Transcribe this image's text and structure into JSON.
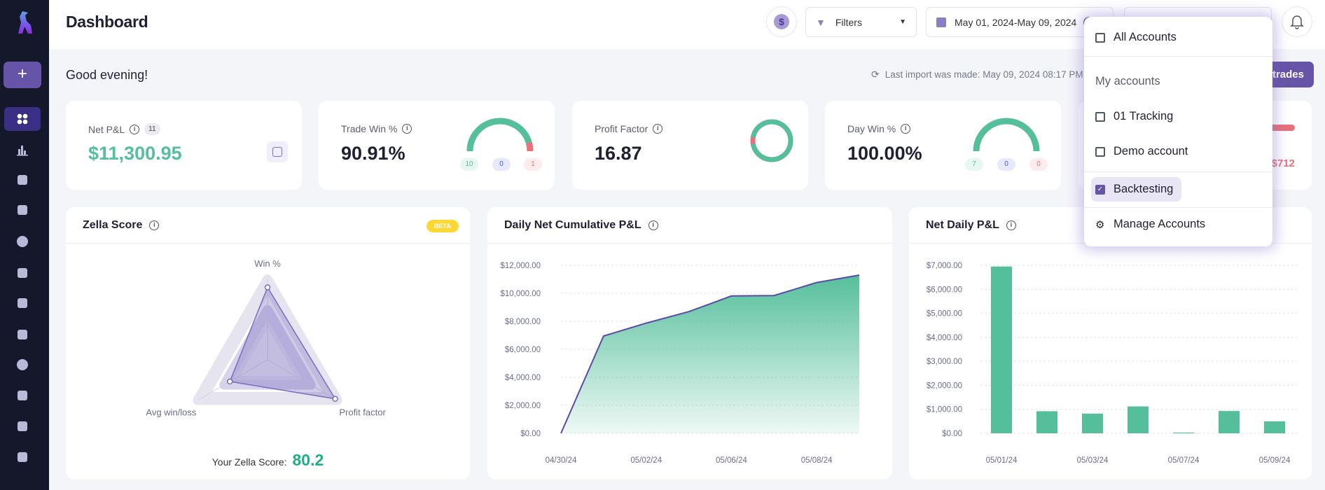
{
  "header": {
    "title": "Dashboard",
    "filters_label": "Filters",
    "date_range": "May 01, 2024-May 09, 2024"
  },
  "greeting": "Good evening!",
  "last_import": "Last import was made: May 09, 2024 08:17 PM",
  "import_button": "trades",
  "colors": {
    "accent": "#6554a7",
    "positive": "#55bf9b",
    "negative": "#e8717a",
    "sidebar": "#15172a"
  },
  "sidebar": {
    "items": [
      "dashboard-icon",
      "reports-icon",
      "daily-journal-icon",
      "trade-view-icon",
      "alert-icon",
      "academy-icon",
      "notebook-icon",
      "playbook-icon",
      "replay-icon",
      "backtesting-icon",
      "mentor-icon",
      "resources-icon"
    ],
    "active": 0
  },
  "stats": {
    "net_pnl": {
      "label": "Net P&L",
      "count": "11",
      "value": "$11,300.95"
    },
    "trade_win": {
      "label": "Trade Win %",
      "value": "90.91%",
      "wins": "10",
      "breakeven": "0",
      "losses": "1",
      "win_fraction": 0.9091
    },
    "profit_factor": {
      "label": "Profit Factor",
      "value": "16.87",
      "profit_fraction": 0.944
    },
    "day_win": {
      "label": "Day Win %",
      "value": "100.00%",
      "wins": "7",
      "breakeven": "0",
      "losses": "0",
      "win_fraction": 1.0
    },
    "avg_win_loss": {
      "loss_value": "-$712"
    }
  },
  "dropdown": {
    "all_accounts": "All Accounts",
    "section": "My accounts",
    "accounts": [
      {
        "name": "01 Tracking",
        "checked": false
      },
      {
        "name": "Demo account",
        "checked": false
      },
      {
        "name": "Backtesting",
        "checked": true
      }
    ],
    "manage": "Manage Accounts"
  },
  "zella": {
    "title": "Zella Score",
    "beta": "BETA",
    "score_label": "Your Zella Score:",
    "score": "80.2",
    "axes": [
      "Win %",
      "Profit factor",
      "Avg win/loss"
    ],
    "values": [
      0.9,
      0.97,
      0.54
    ]
  },
  "chart_data": [
    {
      "type": "area",
      "title": "Daily Net Cumulative P&L",
      "x": [
        "04/30/24",
        "05/01/24",
        "05/02/24",
        "05/03/24",
        "05/06/24",
        "05/07/24",
        "05/08/24",
        "05/09/24"
      ],
      "values": [
        0,
        6950,
        7870,
        8690,
        9810,
        9840,
        10770,
        11300.95
      ],
      "x_tick_labels": [
        "04/30/24",
        "05/02/24",
        "05/06/24",
        "05/08/24"
      ],
      "y_ticks": [
        "$0.00",
        "$2,000.00",
        "$4,000.00",
        "$6,000.00",
        "$8,000.00",
        "$10,000.00",
        "$12,000.00"
      ],
      "ylim": [
        0,
        12000
      ],
      "grid": true
    },
    {
      "type": "bar",
      "title": "Net Daily P&L",
      "categories": [
        "05/01/24",
        "05/02/24",
        "05/03/24",
        "05/06/24",
        "05/07/24",
        "05/08/24",
        "05/09/24"
      ],
      "values": [
        6950,
        920,
        820,
        1120,
        30,
        930,
        500
      ],
      "x_tick_labels": [
        "05/01/24",
        "05/03/24",
        "05/07/24",
        "05/09/24"
      ],
      "y_ticks": [
        "$0.00",
        "$1,000.00",
        "$2,000.00",
        "$3,000.00",
        "$4,000.00",
        "$5,000.00",
        "$6,000.00",
        "$7,000.00"
      ],
      "ylim": [
        0,
        7000
      ],
      "grid": true
    }
  ]
}
